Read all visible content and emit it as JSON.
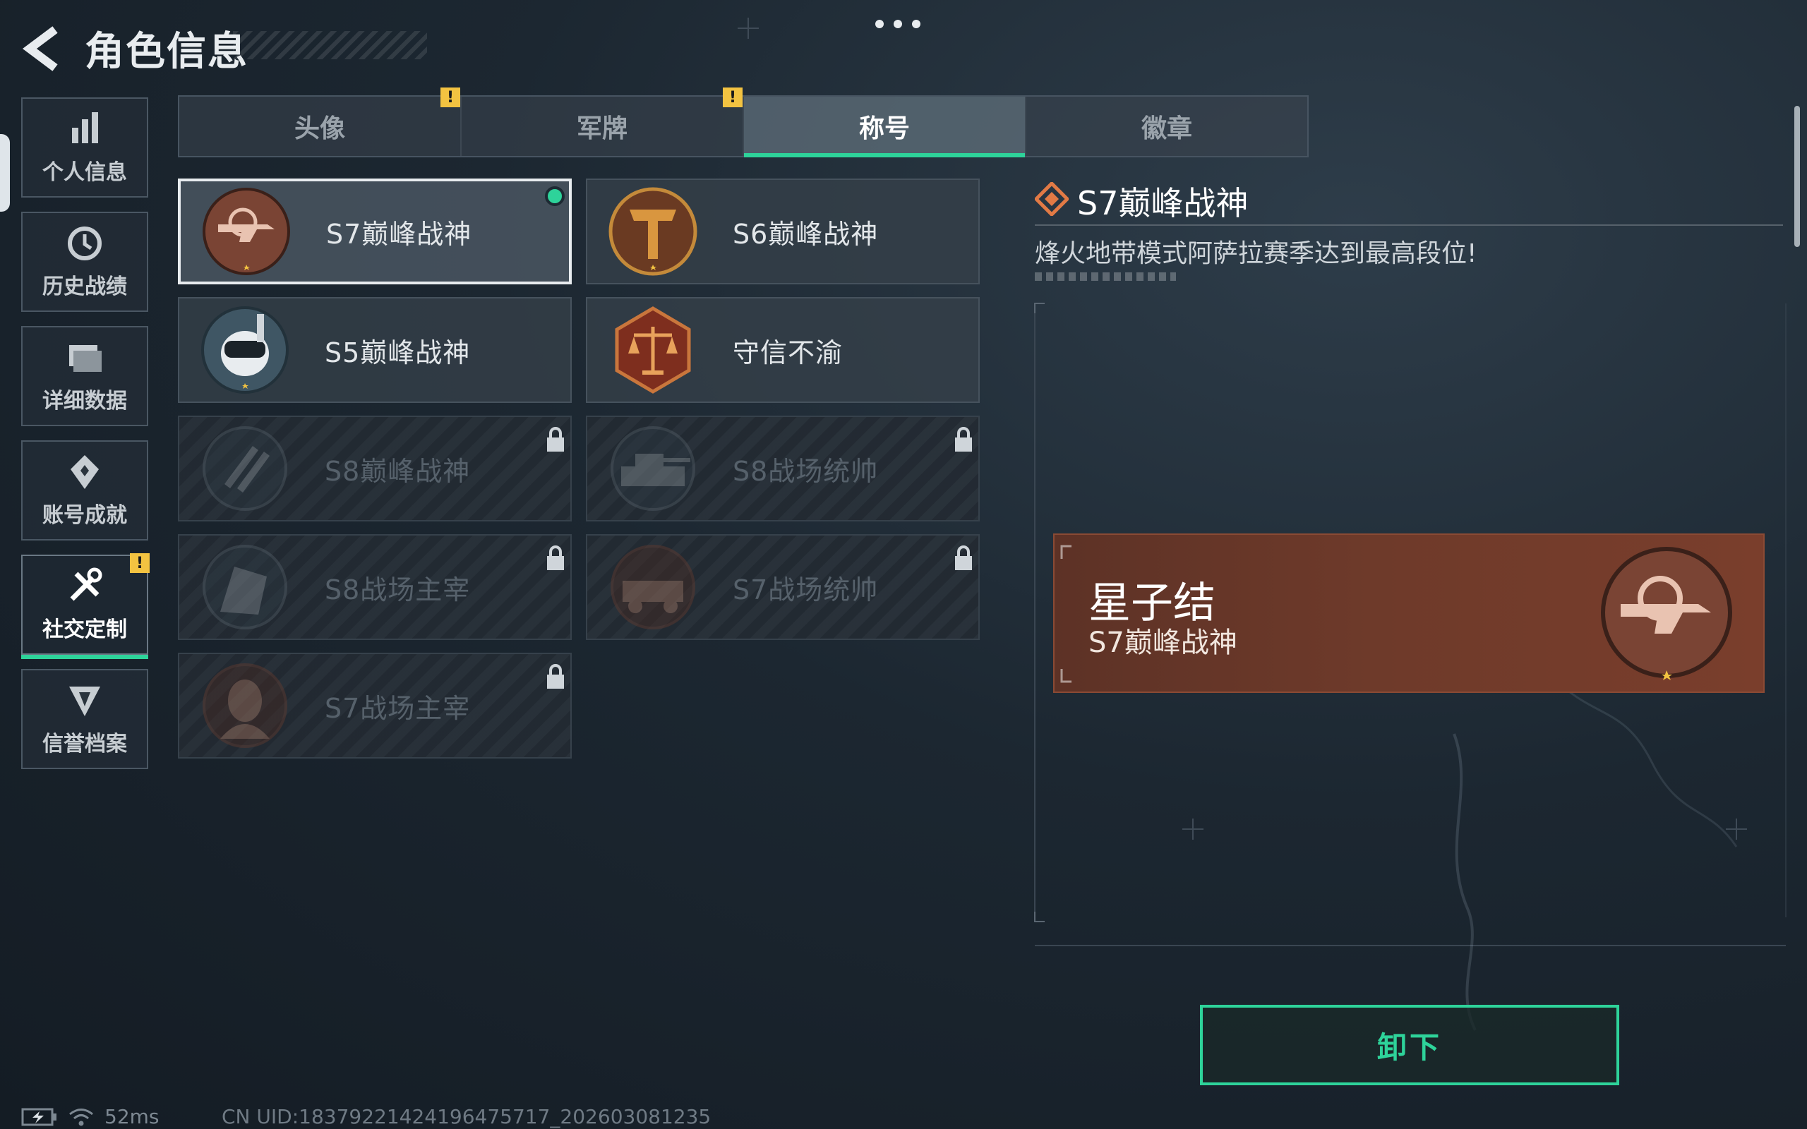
{
  "header": {
    "title": "角色信息"
  },
  "sidebar": {
    "items": [
      {
        "label": "个人信息",
        "icon": "bar-chart-icon"
      },
      {
        "label": "历史战绩",
        "icon": "history-icon"
      },
      {
        "label": "详细数据",
        "icon": "folder-icon"
      },
      {
        "label": "账号成就",
        "icon": "achievement-icon"
      },
      {
        "label": "社交定制",
        "icon": "tools-icon",
        "active": true,
        "alert": "!"
      },
      {
        "label": "信誉档案",
        "icon": "credit-icon"
      }
    ]
  },
  "tabs": [
    {
      "label": "头像",
      "alert": "!"
    },
    {
      "label": "军牌",
      "alert": "!"
    },
    {
      "label": "称号",
      "active": true
    },
    {
      "label": "徽章"
    }
  ],
  "titles": [
    {
      "name": "S7巅峰战神",
      "locked": false,
      "selected": true,
      "equipped": true
    },
    {
      "name": "S6巅峰战神",
      "locked": false
    },
    {
      "name": "S5巅峰战神",
      "locked": false
    },
    {
      "name": "守信不渝",
      "locked": false
    },
    {
      "name": "S8巅峰战神",
      "locked": true
    },
    {
      "name": "S8战场统帅",
      "locked": true
    },
    {
      "name": "S8战场主宰",
      "locked": true
    },
    {
      "name": "S7战场统帅",
      "locked": true
    },
    {
      "name": "S7战场主宰",
      "locked": true
    }
  ],
  "detail": {
    "title": "S7巅峰战神",
    "description": "烽火地带模式阿萨拉赛季达到最高段位!",
    "preview_name": "星子结",
    "preview_title": "S7巅峰战神"
  },
  "actions": {
    "unequip_label": "卸下"
  },
  "footer": {
    "ping": "52ms",
    "uid": "CN UID:1837922142419647571​7_202603081235"
  },
  "colors": {
    "accent": "#2ed39a",
    "alert": "#f3c341",
    "preview_bg": "#6e3a2a"
  }
}
